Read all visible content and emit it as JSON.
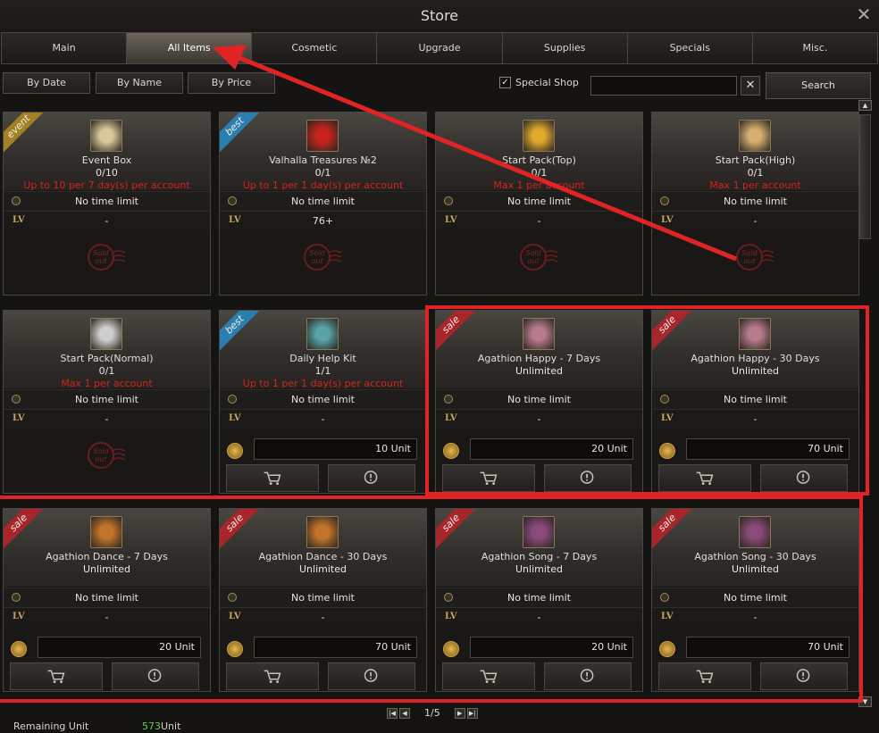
{
  "window": {
    "title": "Store"
  },
  "tabs": [
    "Main",
    "All Items",
    "Cosmetic",
    "Upgrade",
    "Supplies",
    "Specials",
    "Misc."
  ],
  "active_tab": 1,
  "sort_buttons": [
    "By Date",
    "By Name",
    "By Price"
  ],
  "special_shop": {
    "label": "Special Shop",
    "checked": true,
    "check_glyph": "✓"
  },
  "search": {
    "value": "",
    "placeholder": "",
    "clear_label": "✕",
    "button_label": "Search"
  },
  "items": [
    {
      "ribbon": "event",
      "icon": "box-icon",
      "icon_color": "#d8c89a",
      "name": "Event Box",
      "qty": "0/10",
      "limit": "Up to 10 per 7 day(s) per account",
      "time": "No time limit",
      "lv_label": "LV",
      "lv": "-",
      "sold_out": true
    },
    {
      "ribbon": "best",
      "icon": "treasure-icon",
      "icon_color": "#c7231c",
      "name": "Valhalla Treasures №2",
      "qty": "0/1",
      "limit": "Up to 1 per 1 day(s) per account",
      "time": "No time limit",
      "lv_label": "LV",
      "lv": "76+",
      "sold_out": true
    },
    {
      "ribbon": "",
      "icon": "chest-icon",
      "icon_color": "#e0a92e",
      "name": "Start Pack(Top)",
      "qty": "0/1",
      "limit": "Max 1 per account",
      "time": "No time limit",
      "lv_label": "LV",
      "lv": "-",
      "sold_out": true
    },
    {
      "ribbon": "",
      "icon": "chest-icon",
      "icon_color": "#d6b070",
      "name": "Start Pack(High)",
      "qty": "0/1",
      "limit": "Max 1 per account",
      "time": "No time limit",
      "lv_label": "LV",
      "lv": "-",
      "sold_out": true
    },
    {
      "ribbon": "",
      "icon": "chest-icon",
      "icon_color": "#cfcfcf",
      "name": "Start Pack(Normal)",
      "qty": "0/1",
      "limit": "Max 1 per account",
      "time": "No time limit",
      "lv_label": "LV",
      "lv": "-",
      "sold_out": true
    },
    {
      "ribbon": "best",
      "icon": "kit-icon",
      "icon_color": "#5aa3a8",
      "name": "Daily Help Kit",
      "qty": "1/1",
      "limit": "Up to 1 per 1 day(s) per account",
      "time": "No time limit",
      "lv_label": "LV",
      "lv": "-",
      "sold_out": false,
      "price": "10 Unit"
    },
    {
      "ribbon": "sale",
      "icon": "agathion-icon",
      "icon_color": "#b77b8c",
      "name": "Agathion Happy - 7 Days",
      "qty": "Unlimited",
      "limit": "",
      "time": "No time limit",
      "lv_label": "LV",
      "lv": "-",
      "sold_out": false,
      "price": "20 Unit"
    },
    {
      "ribbon": "sale",
      "icon": "agathion-icon",
      "icon_color": "#b77b8c",
      "name": "Agathion Happy - 30 Days",
      "qty": "Unlimited",
      "limit": "",
      "time": "No time limit",
      "lv_label": "LV",
      "lv": "-",
      "sold_out": false,
      "price": "70 Unit"
    },
    {
      "ribbon": "sale",
      "icon": "agathion-icon",
      "icon_color": "#c4742a",
      "name": "Agathion Dance - 7 Days",
      "qty": "Unlimited",
      "limit": "",
      "time": "No time limit",
      "lv_label": "LV",
      "lv": "-",
      "sold_out": false,
      "price": "20 Unit"
    },
    {
      "ribbon": "sale",
      "icon": "agathion-icon",
      "icon_color": "#c4742a",
      "name": "Agathion Dance - 30 Days",
      "qty": "Unlimited",
      "limit": "",
      "time": "No time limit",
      "lv_label": "LV",
      "lv": "-",
      "sold_out": false,
      "price": "70 Unit"
    },
    {
      "ribbon": "sale",
      "icon": "agathion-icon",
      "icon_color": "#8a4a7a",
      "name": "Agathion Song - 7 Days",
      "qty": "Unlimited",
      "limit": "",
      "time": "No time limit",
      "lv_label": "LV",
      "lv": "-",
      "sold_out": false,
      "price": "20 Unit"
    },
    {
      "ribbon": "sale",
      "icon": "agathion-icon",
      "icon_color": "#8a4a7a",
      "name": "Agathion Song - 30 Days",
      "qty": "Unlimited",
      "limit": "",
      "time": "No time limit",
      "lv_label": "LV",
      "lv": "-",
      "sold_out": false,
      "price": "70 Unit"
    }
  ],
  "sold_out_stamp": [
    "Sold",
    "out"
  ],
  "pagination": {
    "text": "1/5"
  },
  "footer": {
    "label": "Remaining Unit",
    "value": "573",
    "unit": "Unit"
  },
  "colors": {
    "accent_red": "#e02426",
    "limit_red": "#d4231c",
    "remaining_green": "#5fd04f"
  }
}
